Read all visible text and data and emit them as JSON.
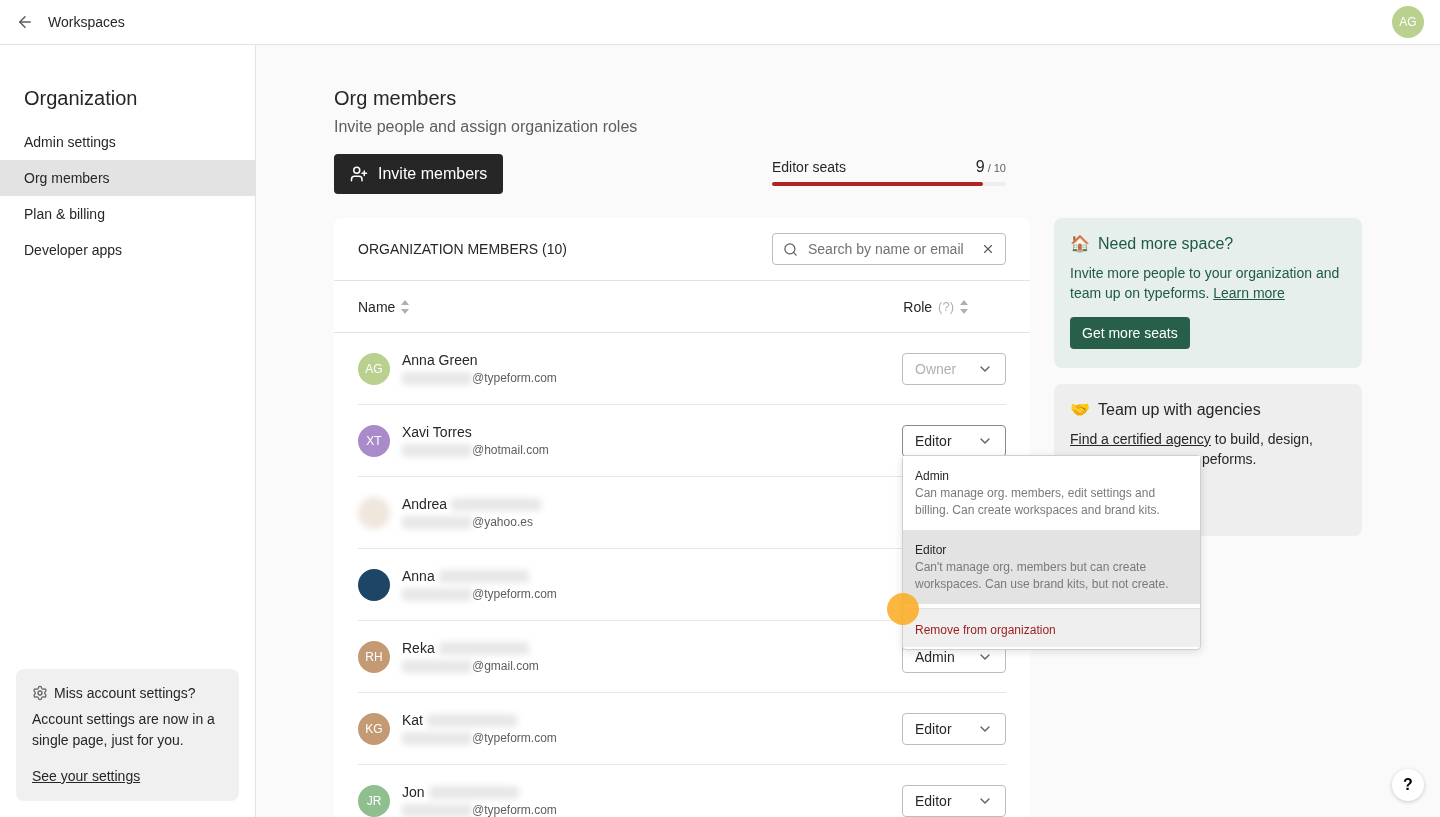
{
  "topbar": {
    "back_label": "Workspaces",
    "avatar_initials": "AG"
  },
  "sidebar": {
    "title": "Organization",
    "items": [
      {
        "label": "Admin settings",
        "selected": false
      },
      {
        "label": "Org members",
        "selected": true
      },
      {
        "label": "Plan & billing",
        "selected": false
      },
      {
        "label": "Developer apps",
        "selected": false
      }
    ],
    "notice": {
      "title": "Miss account settings?",
      "text": "Account settings are now in a single page, just for you.",
      "link": "See your settings"
    }
  },
  "page": {
    "title": "Org members",
    "subtitle": "Invite people and assign organization roles",
    "invite_button": "Invite members",
    "seats": {
      "label": "Editor seats",
      "used": "9",
      "total": "/ 10",
      "level": 0.9
    }
  },
  "members_table": {
    "title": "ORGANIZATION MEMBERS (10)",
    "search": {
      "placeholder": "Search by name or email"
    },
    "columns": [
      {
        "label": "Name"
      },
      {
        "label": "Role",
        "hint": "(?)"
      }
    ],
    "rows": [
      {
        "name": "Anna Green",
        "name_blurred": false,
        "avatar": {
          "initials": "AG",
          "color": "#b9d08f"
        },
        "email": "@typeform.com",
        "role": {
          "value": "Owner",
          "disabled": true,
          "expanded": false
        }
      },
      {
        "name": "Xavi Torres",
        "name_blurred": false,
        "avatar": {
          "initials": "XT",
          "color": "#a98bc9"
        },
        "email": "@hotmail.com",
        "role": {
          "value": "Editor",
          "disabled": false,
          "expanded": true
        }
      },
      {
        "name": "Andrea",
        "name_blurred": true,
        "avatar": {
          "kind": "blurred",
          "color": "#efe6dc"
        },
        "email": "@yahoo.es"
      },
      {
        "name": "Anna",
        "name_blurred": true,
        "avatar": {
          "color": "#1d4566"
        },
        "email": "@typeform.com"
      },
      {
        "name": "Reka",
        "name_blurred": true,
        "avatar": {
          "initials": "RH",
          "color": "#c49a74"
        },
        "email": "@gmail.com",
        "role": {
          "value": "Admin",
          "disabled": false,
          "expanded": false
        }
      },
      {
        "name": "Kat",
        "name_blurred": true,
        "avatar": {
          "initials": "KG",
          "color": "#c49a74"
        },
        "email": "@typeform.com",
        "role": {
          "value": "Editor",
          "disabled": false,
          "expanded": false
        }
      },
      {
        "name": "Jon",
        "name_blurred": true,
        "avatar": {
          "initials": "JR",
          "color": "#8fbf8f"
        },
        "email": "@typeform.com",
        "role": {
          "value": "Editor",
          "disabled": false,
          "expanded": false
        }
      }
    ]
  },
  "role_menu": {
    "options": [
      {
        "kind": "role",
        "title": "Admin",
        "description": "Can manage org. members, edit settings and billing. Can create workspaces and brand kits.",
        "selected": false
      },
      {
        "kind": "role",
        "title": "Editor",
        "description": "Can't manage org. members but can create workspaces. Can use brand kits, but not create.",
        "selected": true
      },
      {
        "kind": "danger",
        "title": "Remove from organization",
        "selected": false
      }
    ]
  },
  "cards": [
    {
      "kind": "green",
      "emoji": "🏠",
      "title": "Need more space?",
      "text": "Invite more people to your organization and team up on typeforms.",
      "link": "Learn more",
      "button": "Get more seats"
    },
    {
      "kind": "grey",
      "emoji": "🤝",
      "title": "Team up with agencies",
      "link": "Find a certified agency",
      "text": "to build, design,",
      "text_covered": "peforms."
    }
  ],
  "help_button": "?"
}
